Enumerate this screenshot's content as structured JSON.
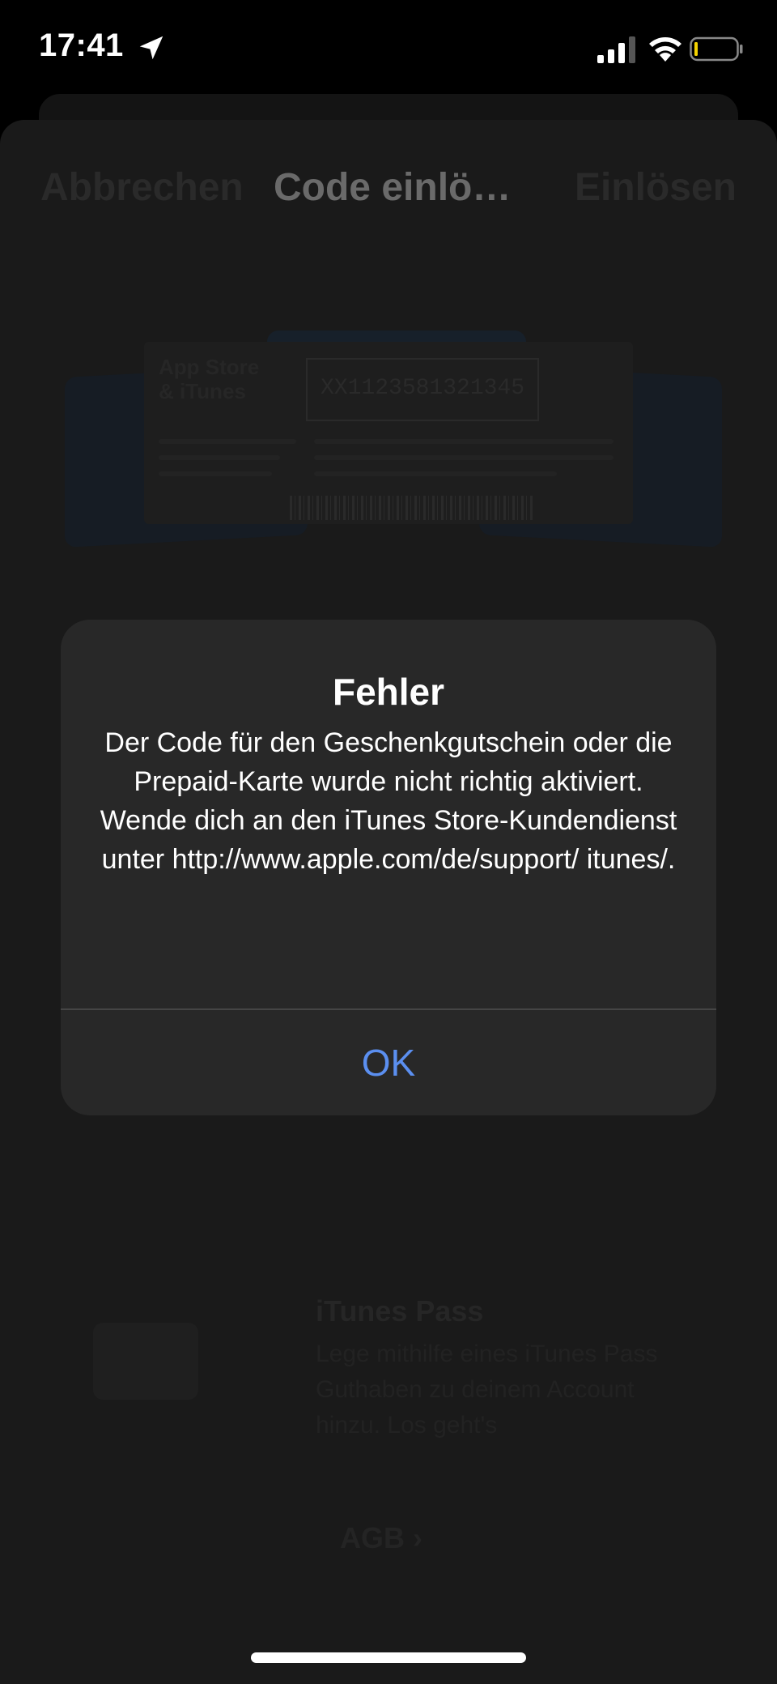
{
  "status_bar": {
    "time": "17:41"
  },
  "nav": {
    "cancel_label": "Abbrechen",
    "title": "Code einlö…",
    "redeem_label": "Einlösen"
  },
  "card": {
    "title_line1": "App Store",
    "title_line2": "& iTunes",
    "code": "XX1123581321345"
  },
  "itunes_pass": {
    "title": "iTunes Pass",
    "description": "Lege mithilfe eines iTunes Pass Guthaben zu deinem Account hinzu. Los geht's"
  },
  "agb_label": "AGB ›",
  "alert": {
    "title": "Fehler",
    "message": "Der Code für den Geschenkgutschein oder die Prepaid-Karte wurde nicht richtig aktiviert. Wende dich an den iTunes Store-Kundendienst unter http://www.apple.com/de/support/ itunes/.",
    "ok_label": "OK"
  },
  "colors": {
    "accent": "#5b8ff0",
    "alert_bg": "#282828",
    "backdrop": "#000000"
  }
}
